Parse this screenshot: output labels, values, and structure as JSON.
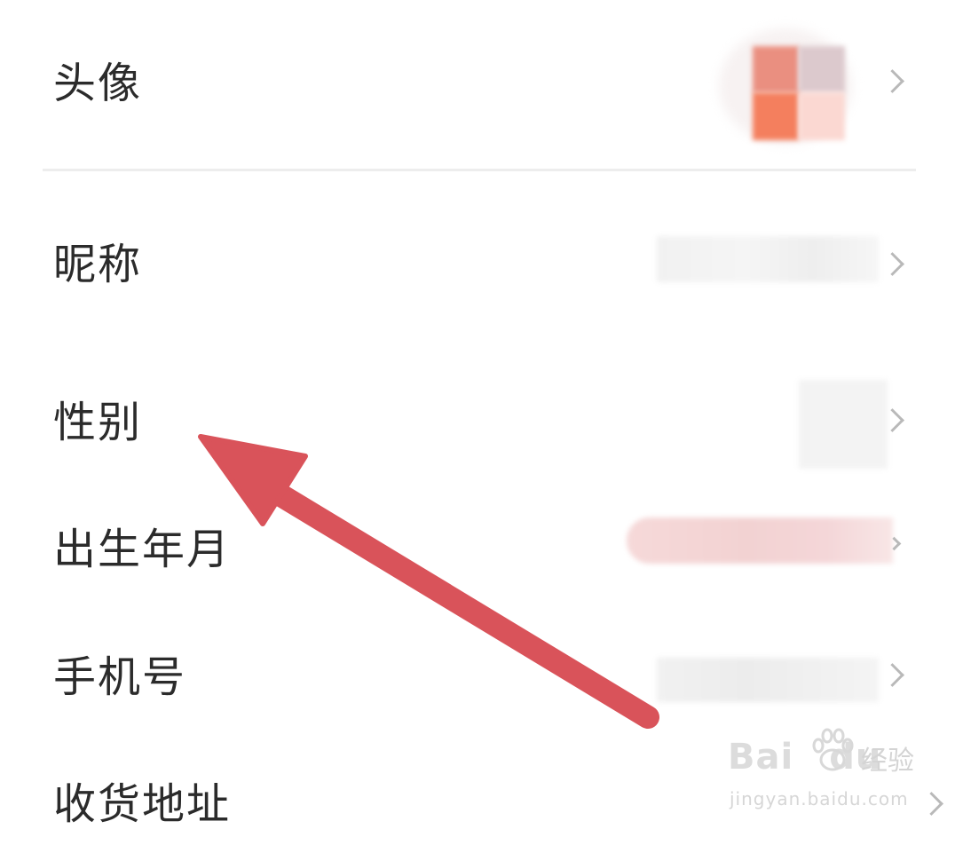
{
  "rows": [
    {
      "label": "头像"
    },
    {
      "label": "昵称"
    },
    {
      "label": "性别"
    },
    {
      "label": "出生年月"
    },
    {
      "label": "手机号"
    },
    {
      "label": "收货地址"
    }
  ],
  "watermark": {
    "brand": "Bai",
    "brand2": "du",
    "jingyan": "经验",
    "url": "jingyan.baidu.com"
  },
  "colors": {
    "arrow": "#d9535a",
    "label": "#2b2b2b",
    "chevron": "#b9b9b9",
    "divider": "#ededed"
  }
}
